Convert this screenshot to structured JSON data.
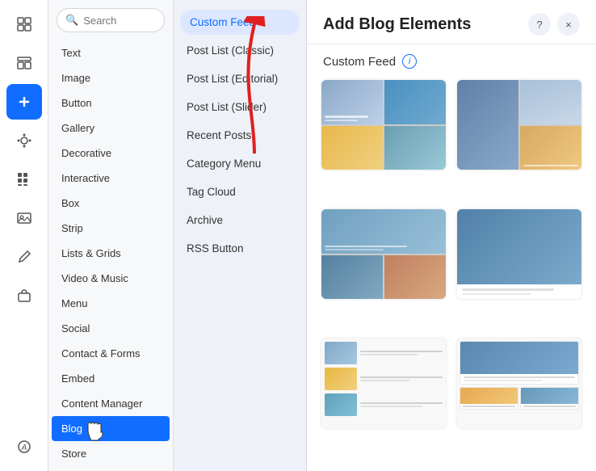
{
  "iconBar": {
    "items": [
      {
        "name": "pages-icon",
        "symbol": "⊞",
        "label": "Pages",
        "active": false
      },
      {
        "name": "elements-icon",
        "symbol": "▢",
        "label": "Elements",
        "active": false
      },
      {
        "name": "add-icon",
        "symbol": "+",
        "label": "Add",
        "active": true
      },
      {
        "name": "design-icon",
        "symbol": "A",
        "label": "Design",
        "active": false
      },
      {
        "name": "apps-icon",
        "symbol": "⊞",
        "label": "Apps",
        "active": false
      },
      {
        "name": "media-icon",
        "symbol": "▣",
        "label": "Media",
        "active": false
      },
      {
        "name": "pen-icon",
        "symbol": "✏",
        "label": "Pen",
        "active": false
      },
      {
        "name": "market-icon",
        "symbol": "🛒",
        "label": "Market",
        "active": false
      },
      {
        "name": "assets-icon",
        "symbol": "A",
        "label": "Assets",
        "active": false
      }
    ]
  },
  "search": {
    "placeholder": "Search",
    "label": "Search"
  },
  "categories": {
    "items": [
      {
        "label": "Text",
        "active": false
      },
      {
        "label": "Image",
        "active": false
      },
      {
        "label": "Button",
        "active": false
      },
      {
        "label": "Gallery",
        "active": false
      },
      {
        "label": "Decorative",
        "active": false
      },
      {
        "label": "Interactive",
        "active": false
      },
      {
        "label": "Box",
        "active": false
      },
      {
        "label": "Strip",
        "active": false
      },
      {
        "label": "Lists & Grids",
        "active": false
      },
      {
        "label": "Video & Music",
        "active": false
      },
      {
        "label": "Menu",
        "active": false
      },
      {
        "label": "Social",
        "active": false
      },
      {
        "label": "Contact & Forms",
        "active": false
      },
      {
        "label": "Embed",
        "active": false
      },
      {
        "label": "Content Manager",
        "active": false
      },
      {
        "label": "Blog",
        "active": true
      },
      {
        "label": "Store",
        "active": false
      }
    ]
  },
  "subcategories": {
    "items": [
      {
        "label": "Custom Feed",
        "active": true
      },
      {
        "label": "Post List (Classic)",
        "active": false
      },
      {
        "label": "Post List (Editorial)",
        "active": false
      },
      {
        "label": "Post List (Slider)",
        "active": false
      },
      {
        "label": "Recent Posts",
        "active": false
      },
      {
        "label": "Category Menu",
        "active": false
      },
      {
        "label": "Tag Cloud",
        "active": false
      },
      {
        "label": "Archive",
        "active": false
      },
      {
        "label": "RSS Button",
        "active": false
      }
    ]
  },
  "mainPanel": {
    "title": "Add Blog Elements",
    "helpLabel": "?",
    "closeLabel": "×",
    "sectionTitle": "Custom Feed",
    "infoLabel": "i",
    "thumbnails": [
      {
        "id": 1,
        "style": "grid-2x2"
      },
      {
        "id": 2,
        "style": "single-right"
      },
      {
        "id": 3,
        "style": "grid-overlap"
      },
      {
        "id": 4,
        "style": "single-wide"
      },
      {
        "id": 5,
        "style": "list-style"
      },
      {
        "id": 6,
        "style": "card-style"
      }
    ]
  },
  "cursor": "👆"
}
